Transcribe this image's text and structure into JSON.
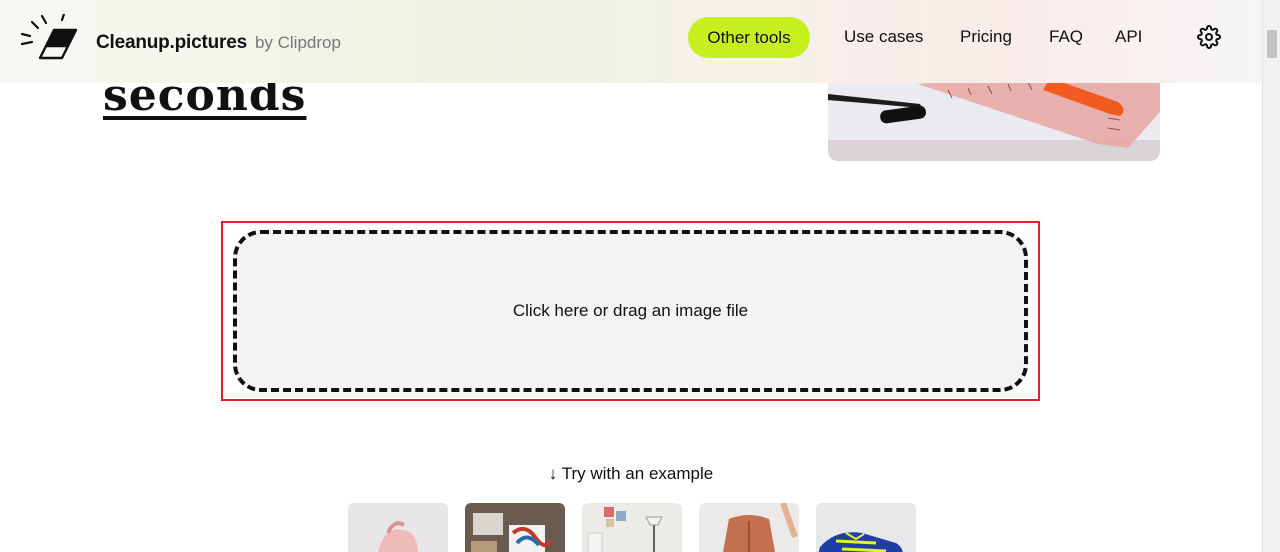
{
  "header": {
    "brand_name": "Cleanup.pictures",
    "brand_by": "by Clipdrop",
    "nav": {
      "other_tools": "Other tools",
      "use_cases": "Use cases",
      "pricing": "Pricing",
      "faq": "FAQ",
      "api": "API"
    },
    "accent_color": "#c6f01d",
    "settings_icon": "gear-icon"
  },
  "hero": {
    "word": "seconds"
  },
  "upload": {
    "label": "Click here or drag an image file",
    "highlight_color": "#e0202a"
  },
  "examples": {
    "title": "↓ Try with an example",
    "items": [
      {
        "subject": "pink-bag"
      },
      {
        "subject": "desk-items"
      },
      {
        "subject": "room-interior"
      },
      {
        "subject": "jacket"
      },
      {
        "subject": "sneakers"
      }
    ]
  }
}
